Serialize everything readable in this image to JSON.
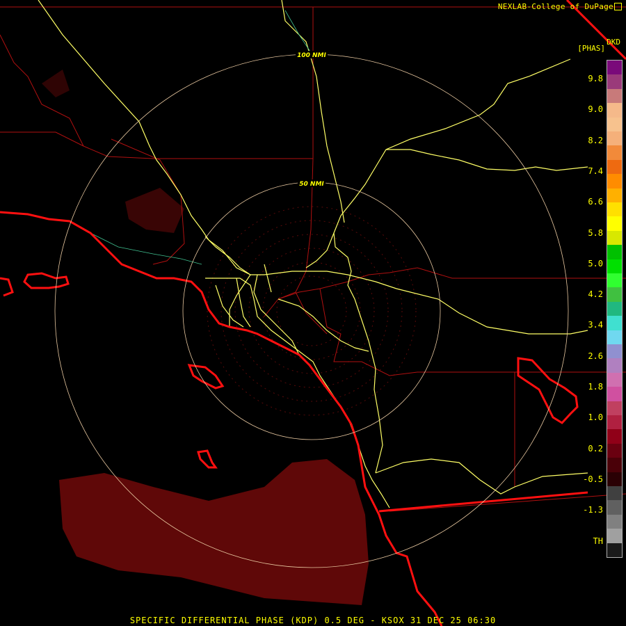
{
  "header": {
    "credit": "NEXLAB-College of DuPage",
    "product_code": "DKD",
    "product_unit": "[PHAS]"
  },
  "footer": {
    "caption": "SPECIFIC DIFFERENTIAL PHASE (KDP) 0.5 DEG - KSOX 31 DEC 25 06:30"
  },
  "range_rings": [
    {
      "label": "100 NMI"
    },
    {
      "label": "50 NMI"
    }
  ],
  "legend": {
    "labels": [
      "9.8",
      "9.0",
      "8.2",
      "7.4",
      "6.6",
      "5.8",
      "5.0",
      "4.2",
      "3.4",
      "2.6",
      "1.8",
      "1.0",
      "0.2",
      "-0.5",
      "-1.3",
      "TH"
    ],
    "colors": [
      "#7a0a7a",
      "#9a3a7a",
      "#c87a7a",
      "#f5b98a",
      "#f7c28e",
      "#f5b07a",
      "#f28a3a",
      "#ee6a10",
      "#ff8c00",
      "#ffb000",
      "#ffe000",
      "#ffff00",
      "#d8e800",
      "#00c000",
      "#00e000",
      "#30ff30",
      "#40c040",
      "#20b880",
      "#40e0d0",
      "#70d8f0",
      "#9090d0",
      "#b080c0",
      "#d070b0",
      "#d050a0",
      "#c04060",
      "#b02040",
      "#900018",
      "#6a0010",
      "#4a0008",
      "#2a0004",
      "#404040",
      "#606060",
      "#808080",
      "#a0a0a0",
      "#1a1a1a"
    ]
  },
  "colors": {
    "annotation": "#ffff00",
    "highway": "#ffff66",
    "county_line": "#b01010",
    "coastline": "#ff1010",
    "range_ring": "#e8c8a0",
    "echo": "#6a0a0a"
  }
}
